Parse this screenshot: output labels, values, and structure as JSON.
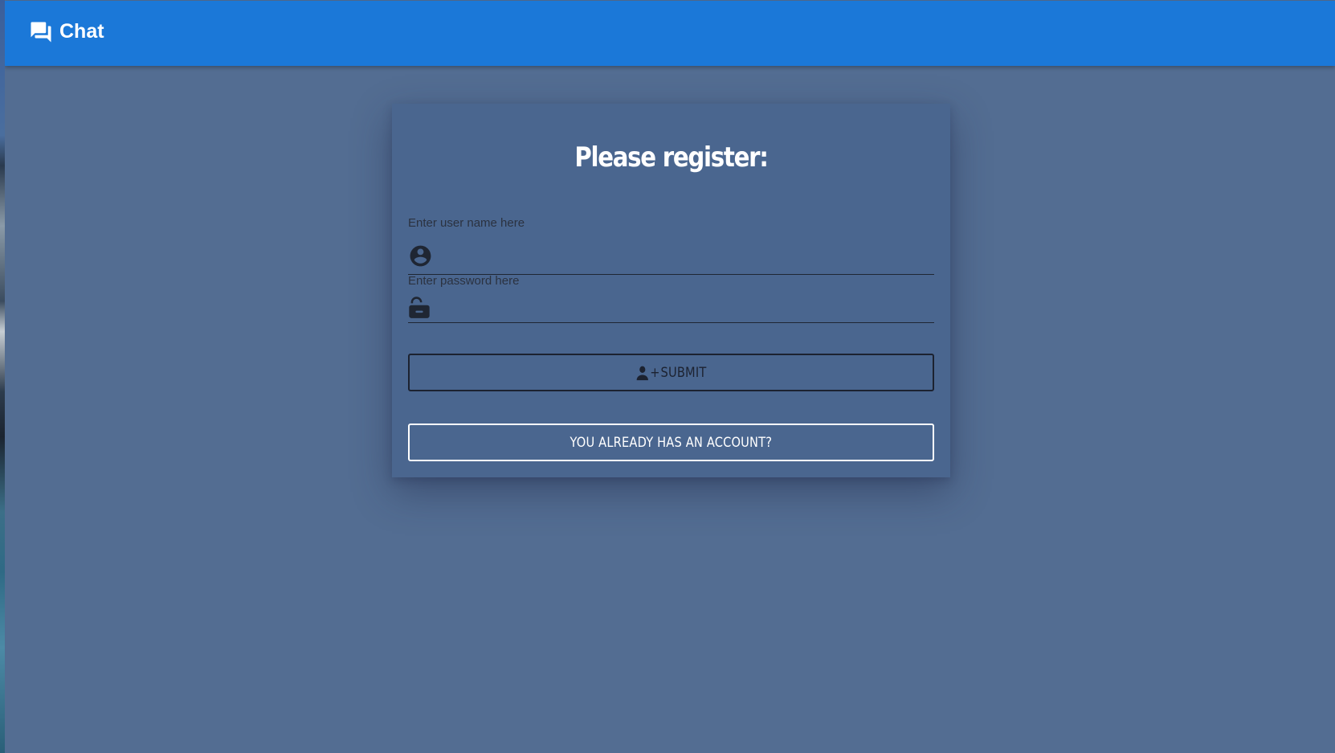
{
  "app_bar": {
    "icon": "forum-icon",
    "title": "Chat",
    "color": "#1b78d8"
  },
  "form": {
    "heading": "Please register:",
    "username": {
      "label": "Enter user name here",
      "value": "",
      "icon": "account-circle-icon"
    },
    "password": {
      "label": "Enter password here",
      "value": "",
      "icon": "lock-open-icon"
    },
    "submit": {
      "icon": "person-add-icon",
      "icon_glyph": "+",
      "label": "SUBMIT"
    },
    "switch_button": {
      "label": "YOU ALREADY HAS AN ACCOUNT?"
    }
  },
  "colors": {
    "background": "#536d92",
    "card": "#4a668f"
  }
}
